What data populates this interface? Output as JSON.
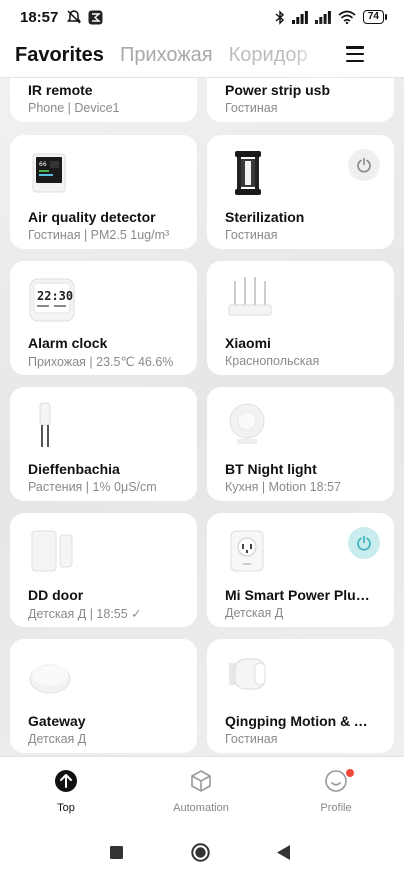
{
  "status_bar": {
    "time": "18:57",
    "left_icons": [
      "mute-icon",
      "app-notification-icon"
    ],
    "right_icons": [
      "bluetooth-icon",
      "signal-icon",
      "signal-icon",
      "wifi-icon"
    ],
    "battery": "74"
  },
  "header": {
    "tabs": [
      {
        "label": "Favorites",
        "active": true
      },
      {
        "label": "Прихожая",
        "active": false
      },
      {
        "label": "Коридор",
        "active": false
      }
    ],
    "menu_icon": "menu-icon"
  },
  "devices": [
    {
      "name": "IR remote",
      "sub": "Phone | Device1",
      "power": null
    },
    {
      "name": "Power strip usb",
      "sub": "Гостиная",
      "power": null
    },
    {
      "name": "Air quality detector",
      "sub": "Гостиная | PM2.5 1ug/m³",
      "power": null
    },
    {
      "name": "Sterilization",
      "sub": "Гостиная",
      "power": "off"
    },
    {
      "name": "Alarm clock",
      "sub": "Прихожая | 23.5℃ 46.6%",
      "power": null,
      "display": "22:30"
    },
    {
      "name": "Xiaomi",
      "sub": "Краснопольская",
      "power": null
    },
    {
      "name": "Dieffenbachia",
      "sub": "Растения | 1% 0μS/cm",
      "power": null
    },
    {
      "name": "BT Night light",
      "sub": "Кухня | Motion 18:57",
      "power": null
    },
    {
      "name": "DD door",
      "sub": "Детская Д | 18:55 ✓",
      "power": null
    },
    {
      "name": "Mi Smart Power Plug...",
      "sub": "Детская Д",
      "power": "on"
    },
    {
      "name": "Gateway",
      "sub": "Детская Д",
      "power": null
    },
    {
      "name": "Qingping Motion & A...",
      "sub": "Гостиная",
      "power": null
    }
  ],
  "bottom_nav": [
    {
      "label": "Top",
      "icon": "top-arrow-icon",
      "active": true
    },
    {
      "label": "Automation",
      "icon": "automation-cube-icon",
      "active": false
    },
    {
      "label": "Profile",
      "icon": "profile-smile-icon",
      "active": false,
      "badge": true
    }
  ],
  "system_nav": [
    "recents-icon",
    "home-icon",
    "back-icon"
  ],
  "colors": {
    "power_on": "#45b7bf",
    "badge": "#f04a3a"
  }
}
